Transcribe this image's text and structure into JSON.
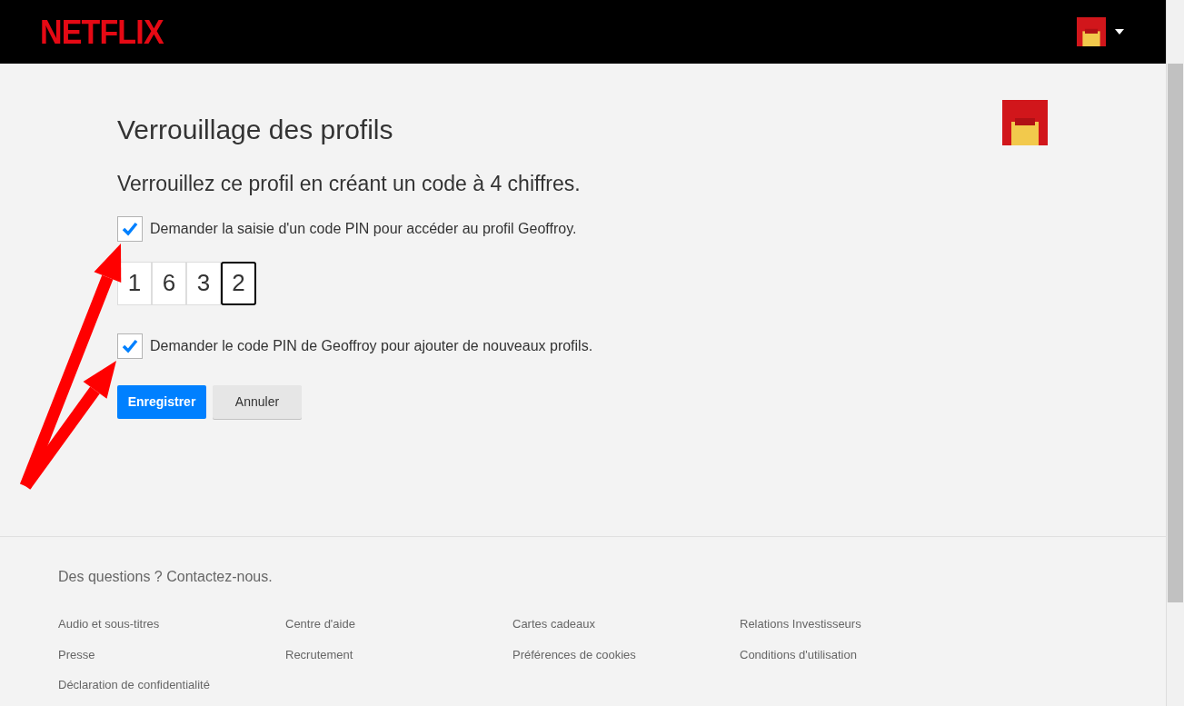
{
  "header": {
    "logo": "NETFLIX"
  },
  "page": {
    "title": "Verrouillage des profils",
    "subtitle": "Verrouillez ce profil en créant un code à 4 chiffres.",
    "options": [
      {
        "label": "Demander la saisie d'un code PIN pour accéder au profil Geoffroy.",
        "checked": true
      }
    ],
    "pin": [
      {
        "digit": "1",
        "focused": false
      },
      {
        "digit": "6",
        "focused": false
      },
      {
        "digit": "3",
        "focused": false
      },
      {
        "digit": "2",
        "focused": true
      }
    ],
    "options_2": [
      {
        "label": "Demander le code PIN de Geoffroy pour ajouter de nouveaux profils.",
        "checked": true
      }
    ],
    "buttons": [
      {
        "label": "Enregistrer",
        "kind": "primary"
      },
      {
        "label": "Annuler",
        "kind": "secondary"
      }
    ]
  },
  "footer": {
    "question": "Des questions ? Contactez-nous.",
    "links": [
      "Audio et sous-titres",
      "Centre d'aide",
      "Cartes cadeaux",
      "Relations Investisseurs",
      "Presse",
      "Recrutement",
      "Préférences de cookies",
      "Conditions d'utilisation",
      "Déclaration de confidentialité"
    ]
  }
}
